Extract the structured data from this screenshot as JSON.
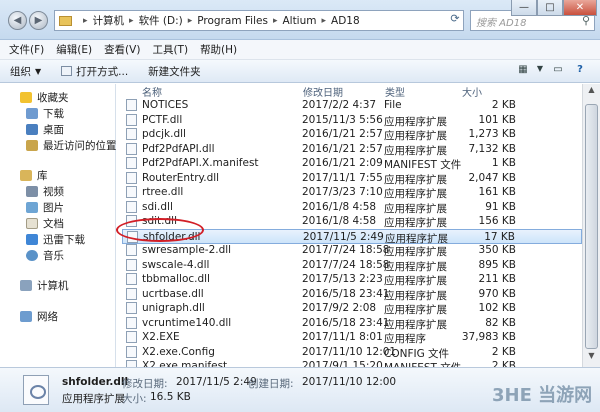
{
  "window": {
    "minimize": "—",
    "maximize": "□",
    "close": "✕"
  },
  "breadcrumb": [
    "计算机",
    "软件 (D:)",
    "Program Files",
    "Altium",
    "AD18"
  ],
  "search": {
    "placeholder": "搜索 AD18"
  },
  "menu": [
    "文件(F)",
    "编辑(E)",
    "查看(V)",
    "工具(T)",
    "帮助(H)"
  ],
  "toolbar": {
    "organize": "组织",
    "open": "打开方式...",
    "new_folder": "新建文件夹"
  },
  "sidebar": {
    "favorites": "收藏夹",
    "fav_items": [
      "下载",
      "桌面",
      "最近访问的位置"
    ],
    "libraries": "库",
    "lib_items": [
      "视频",
      "图片",
      "文档",
      "迅雷下载",
      "音乐"
    ],
    "computer": "计算机",
    "network": "网络"
  },
  "columns": {
    "name": "名称",
    "date": "修改日期",
    "type": "类型",
    "size": "大小"
  },
  "files": [
    {
      "name": "NOTICES",
      "date": "2017/2/2 4:37",
      "type": "File",
      "size": "2 KB"
    },
    {
      "name": "PCTF.dll",
      "date": "2015/11/3 5:56",
      "type": "应用程序扩展",
      "size": "101 KB"
    },
    {
      "name": "pdcjk.dll",
      "date": "2016/1/21 2:57",
      "type": "应用程序扩展",
      "size": "1,273 KB"
    },
    {
      "name": "Pdf2PdfAPI.dll",
      "date": "2016/1/21 2:57",
      "type": "应用程序扩展",
      "size": "7,132 KB"
    },
    {
      "name": "Pdf2PdfAPI.X.manifest",
      "date": "2016/1/21 2:09",
      "type": "MANIFEST 文件",
      "size": "1 KB"
    },
    {
      "name": "RouterEntry.dll",
      "date": "2017/11/1 7:55",
      "type": "应用程序扩展",
      "size": "2,047 KB"
    },
    {
      "name": "rtree.dll",
      "date": "2017/3/23 7:10",
      "type": "应用程序扩展",
      "size": "161 KB"
    },
    {
      "name": "sdi.dll",
      "date": "2016/1/8 4:58",
      "type": "应用程序扩展",
      "size": "91 KB"
    },
    {
      "name": "sdit.dll",
      "date": "2016/1/8 4:58",
      "type": "应用程序扩展",
      "size": "156 KB"
    },
    {
      "name": "shfolder.dll",
      "date": "2017/11/5 2:49",
      "type": "应用程序扩展",
      "size": "17 KB",
      "selected": true
    },
    {
      "name": "swresample-2.dll",
      "date": "2017/7/24 18:58",
      "type": "应用程序扩展",
      "size": "350 KB"
    },
    {
      "name": "swscale-4.dll",
      "date": "2017/7/24 18:58",
      "type": "应用程序扩展",
      "size": "895 KB"
    },
    {
      "name": "tbbmalloc.dll",
      "date": "2017/5/13 2:23",
      "type": "应用程序扩展",
      "size": "211 KB"
    },
    {
      "name": "ucrtbase.dll",
      "date": "2016/5/18 23:41",
      "type": "应用程序扩展",
      "size": "970 KB"
    },
    {
      "name": "unigraph.dll",
      "date": "2017/9/2 2:08",
      "type": "应用程序扩展",
      "size": "102 KB"
    },
    {
      "name": "vcruntime140.dll",
      "date": "2016/5/18 23:41",
      "type": "应用程序扩展",
      "size": "82 KB"
    },
    {
      "name": "X2.EXE",
      "date": "2017/11/1 8:01",
      "type": "应用程序",
      "size": "37,983 KB"
    },
    {
      "name": "X2.exe.Config",
      "date": "2017/11/10 12:01",
      "type": "CONFIG 文件",
      "size": "2 KB"
    },
    {
      "name": "X2.exe.manifest",
      "date": "2017/9/1 15:20",
      "type": "MANIFEST 文件",
      "size": "2 KB"
    }
  ],
  "details": {
    "name": "shfolder.dll",
    "type": "应用程序扩展",
    "modified_label": "修改日期:",
    "modified": "2017/11/5 2:49",
    "size_label": "大小:",
    "size": "16.5 KB",
    "created_label": "创建日期:",
    "created": "2017/11/10 12:00"
  },
  "watermark": "3HE 当游网"
}
